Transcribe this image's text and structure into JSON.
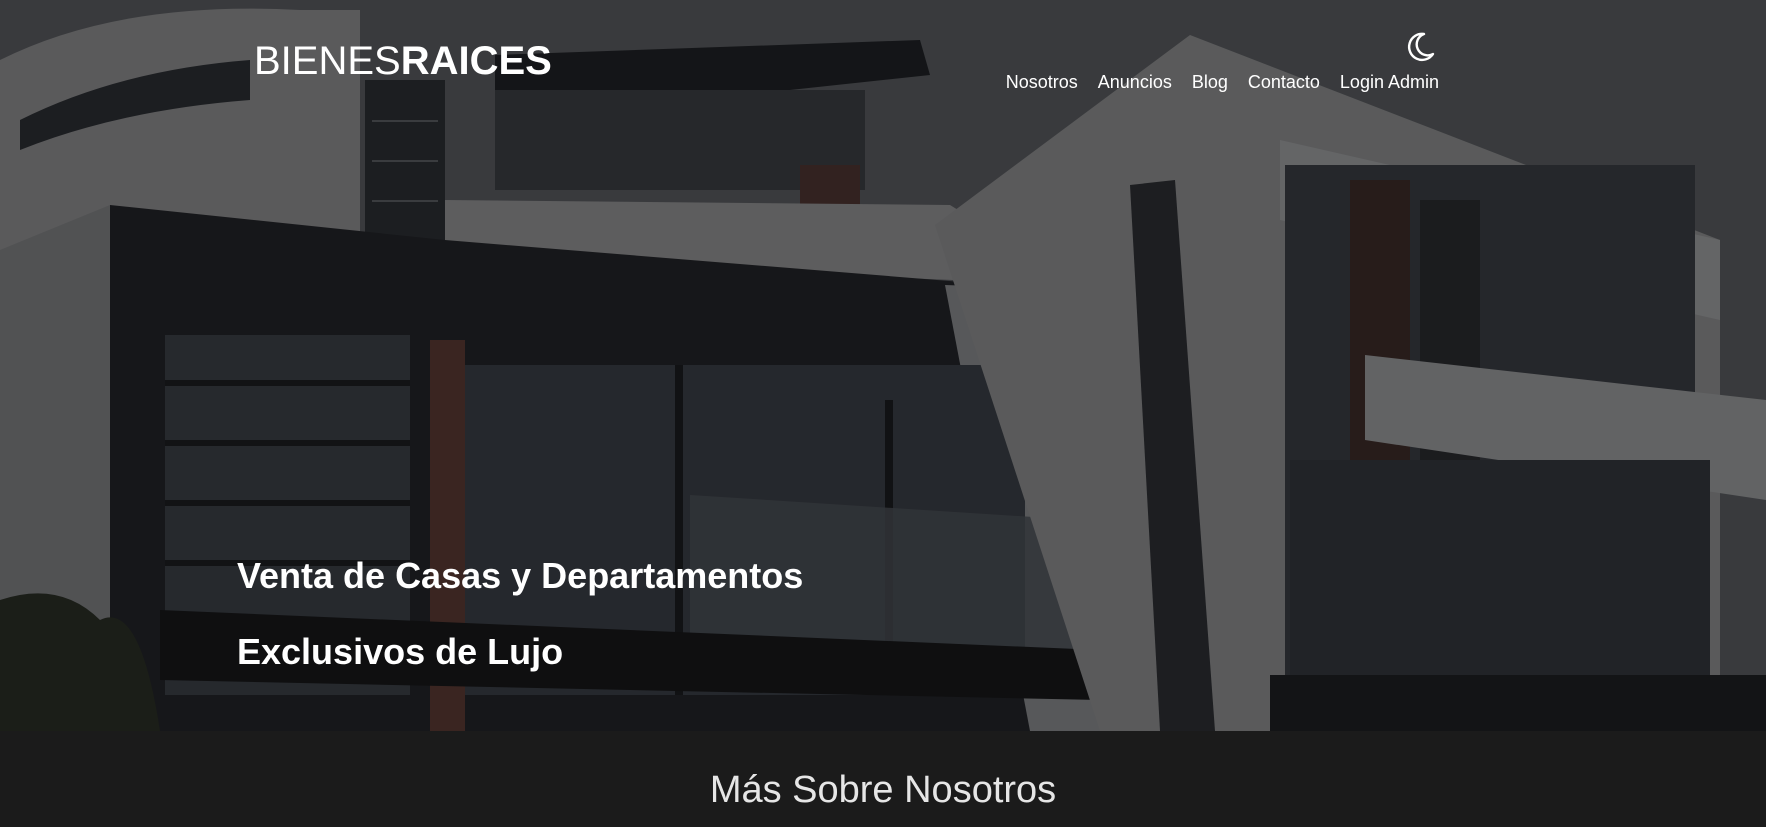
{
  "header": {
    "logo_light": "BIENES",
    "logo_bold": "RAICES",
    "dark_mode_icon": "moon-icon"
  },
  "nav": {
    "items": [
      {
        "label": "Nosotros"
      },
      {
        "label": "Anuncios"
      },
      {
        "label": "Blog"
      },
      {
        "label": "Contacto"
      },
      {
        "label": "Login Admin"
      }
    ]
  },
  "hero": {
    "line1": "Venta de Casas y Departamentos",
    "line2": "Exclusivos de Lujo",
    "background": "photo of modern luxury house facade"
  },
  "about": {
    "title": "Más Sobre Nosotros"
  },
  "colors": {
    "text": "#ffffff",
    "section_bg": "#1b1b1b"
  }
}
